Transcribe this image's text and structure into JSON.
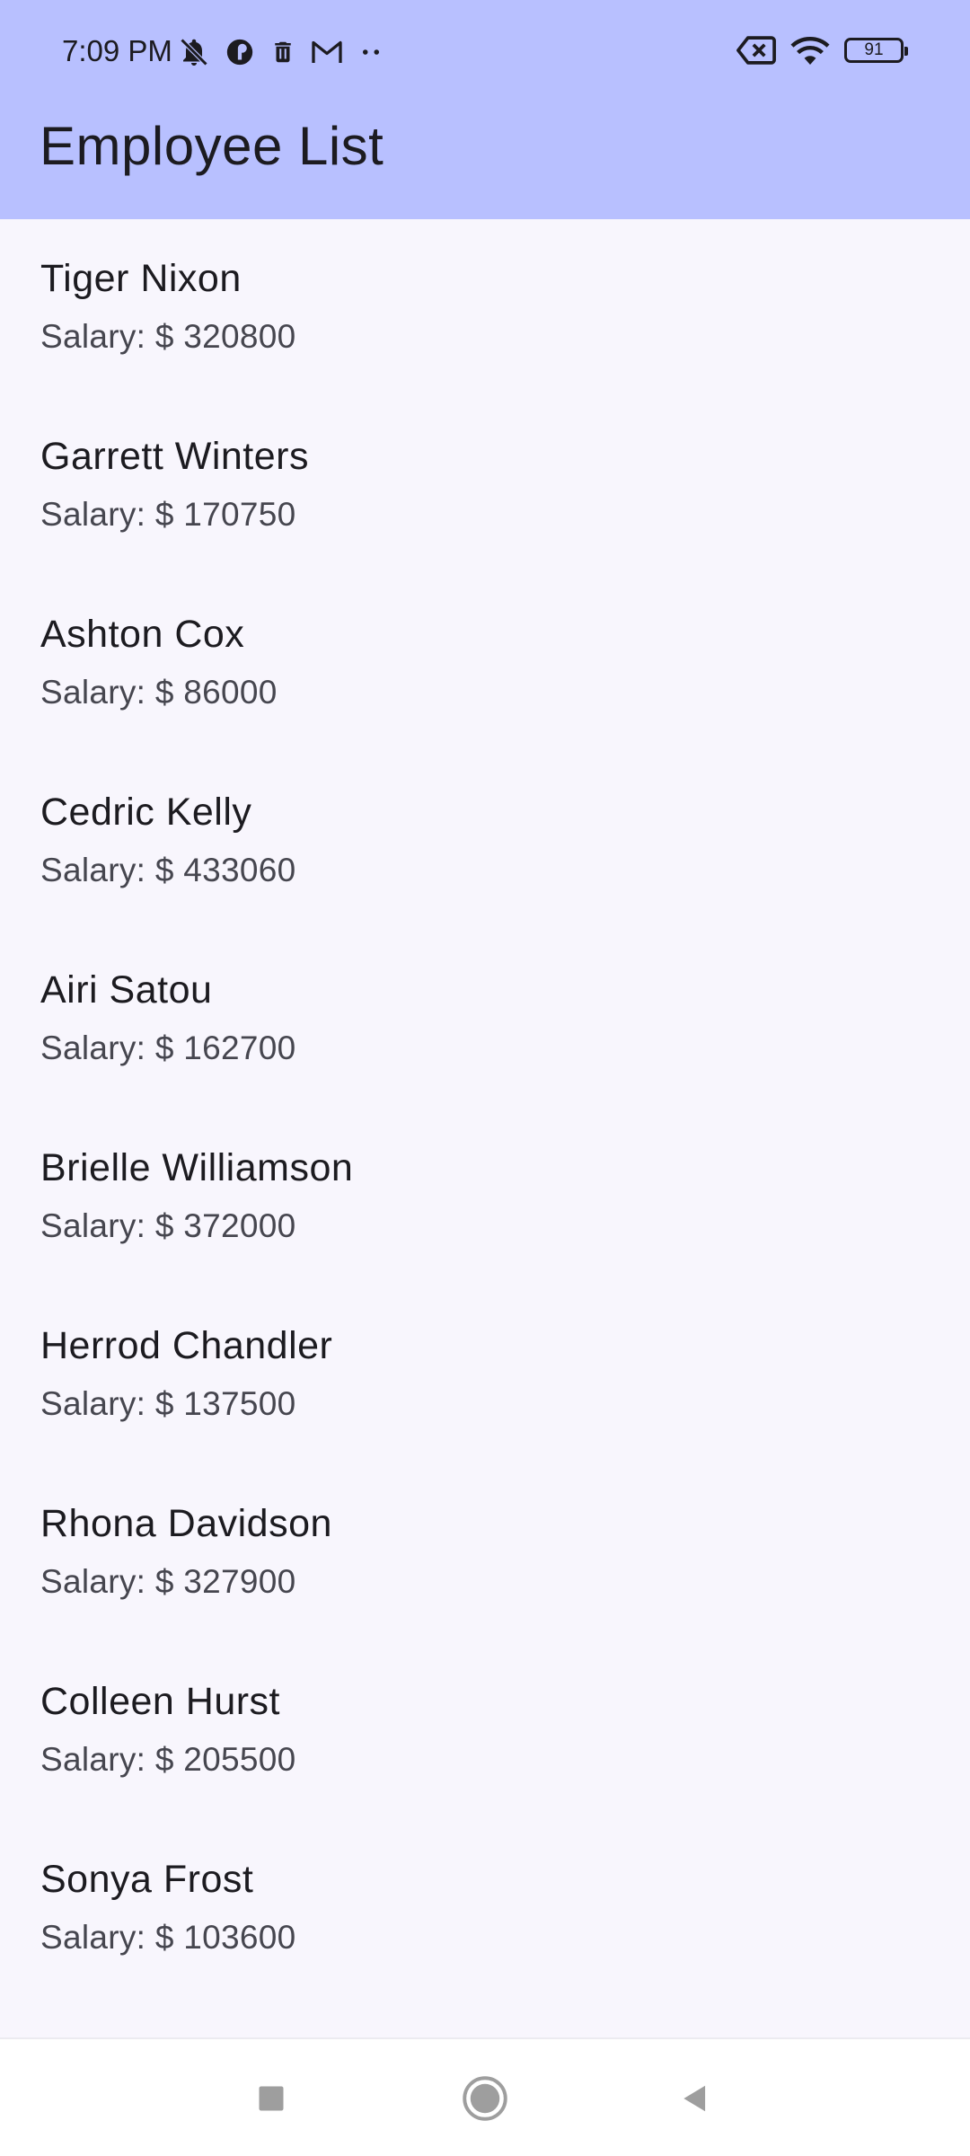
{
  "status_bar": {
    "time": "7:09 PM",
    "battery": "91",
    "icons": [
      "notifications-off-icon",
      "app-circle-icon",
      "trash-icon",
      "mail-icon",
      "more-dots-icon",
      "data-off-icon",
      "wifi-icon",
      "battery-icon"
    ]
  },
  "app_bar": {
    "title": "Employee List",
    "background": "#b8c0ff"
  },
  "employees": [
    {
      "name": "Tiger Nixon",
      "salary": "Salary: $ 320800"
    },
    {
      "name": "Garrett Winters",
      "salary": "Salary: $ 170750"
    },
    {
      "name": "Ashton Cox",
      "salary": "Salary: $ 86000"
    },
    {
      "name": "Cedric Kelly",
      "salary": "Salary: $ 433060"
    },
    {
      "name": "Airi Satou",
      "salary": "Salary: $ 162700"
    },
    {
      "name": "Brielle Williamson",
      "salary": "Salary: $ 372000"
    },
    {
      "name": "Herrod Chandler",
      "salary": "Salary: $ 137500"
    },
    {
      "name": "Rhona Davidson",
      "salary": "Salary: $ 327900"
    },
    {
      "name": "Colleen Hurst",
      "salary": "Salary: $ 205500"
    },
    {
      "name": "Sonya Frost",
      "salary": "Salary: $ 103600"
    }
  ],
  "nav_bar": {
    "buttons": [
      "recents-button",
      "home-button",
      "back-button"
    ]
  }
}
